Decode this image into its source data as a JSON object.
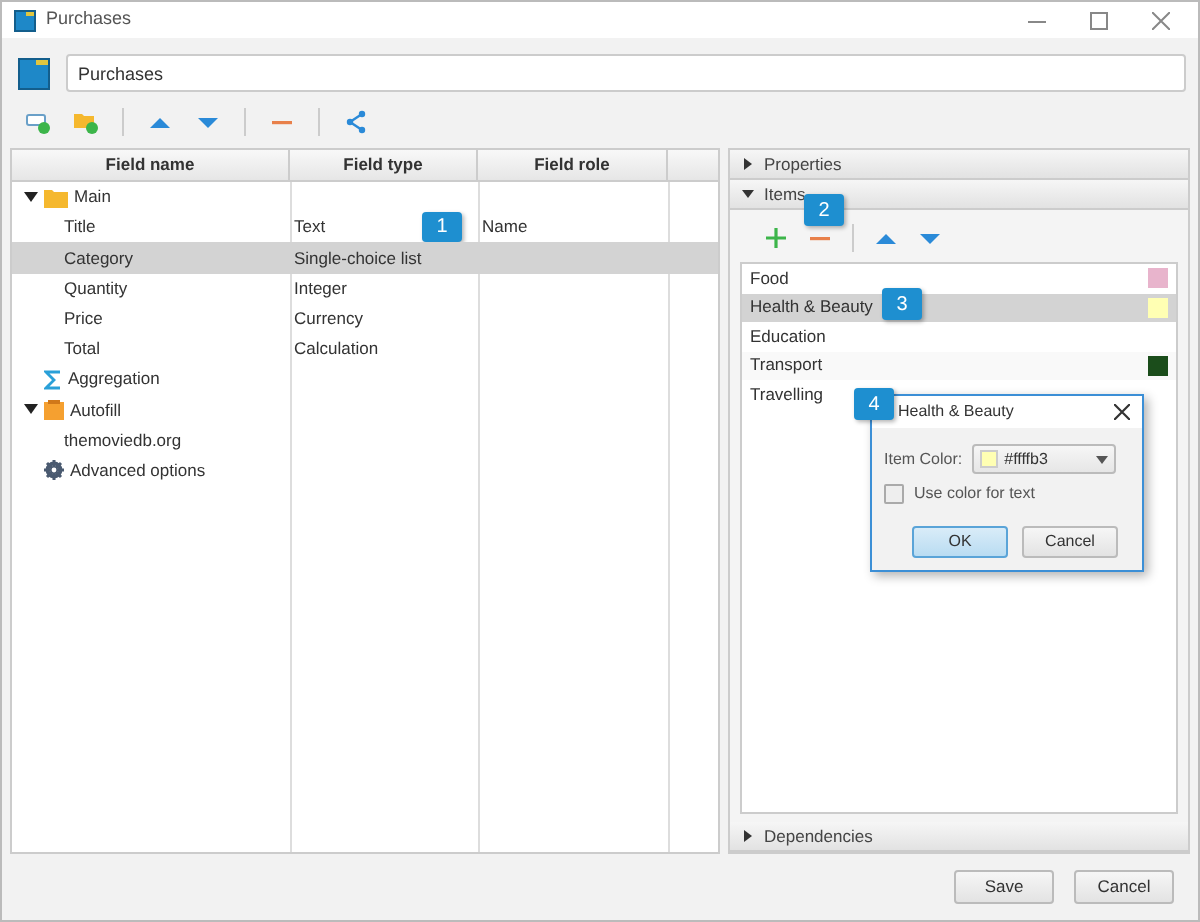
{
  "window": {
    "title": "Purchases"
  },
  "name_field": {
    "value": "Purchases"
  },
  "fields_table": {
    "columns": [
      "Field name",
      "Field type",
      "Field role"
    ],
    "rows": [
      {
        "name": "Main",
        "kind": "folder",
        "expanded": true,
        "selected": false,
        "children": [
          {
            "name": "Title",
            "type": "Text",
            "role": "Name",
            "selected": false
          },
          {
            "name": "Category",
            "type": "Single-choice list",
            "selected": true
          },
          {
            "name": "Quantity",
            "type": "Integer",
            "selected": false
          },
          {
            "name": "Price",
            "type": "Currency",
            "selected": false
          },
          {
            "name": "Total",
            "type": "Calculation",
            "selected": false
          }
        ]
      },
      {
        "name": "Aggregation",
        "kind": "sigma",
        "selected": false
      },
      {
        "name": "Autofill",
        "kind": "autofill",
        "expanded": true,
        "selected": false,
        "children": [
          {
            "name": "themoviedb.org",
            "selected": false
          }
        ]
      },
      {
        "name": "Advanced options",
        "kind": "gear",
        "selected": false
      }
    ]
  },
  "properties_section": {
    "title": "Properties",
    "expanded": false
  },
  "items_section": {
    "title": "Items",
    "expanded": true,
    "items": [
      {
        "name": "Food",
        "color": "#e8b4cc",
        "selected": false
      },
      {
        "name": "Health & Beauty",
        "color": "#ffffb3",
        "selected": true
      },
      {
        "name": "Education",
        "selected": false
      },
      {
        "name": "Transport",
        "color": "#1b4d1b",
        "selected": false
      },
      {
        "name": "Travelling",
        "selected": false
      }
    ]
  },
  "dependencies_section": {
    "title": "Dependencies",
    "expanded": false
  },
  "item_dialog": {
    "title": "Health & Beauty",
    "color_label": "Item Color:",
    "color_value": "#ffffb3",
    "color": "#ffffb3",
    "use_color_for_text": {
      "label": "Use color for text",
      "checked": false
    },
    "buttons": [
      {
        "label": "OK",
        "default": true
      },
      {
        "label": "Cancel",
        "default": false
      }
    ]
  },
  "callouts": [
    "1",
    "2",
    "3",
    "4"
  ],
  "footer_buttons": [
    "Save",
    "Cancel"
  ]
}
